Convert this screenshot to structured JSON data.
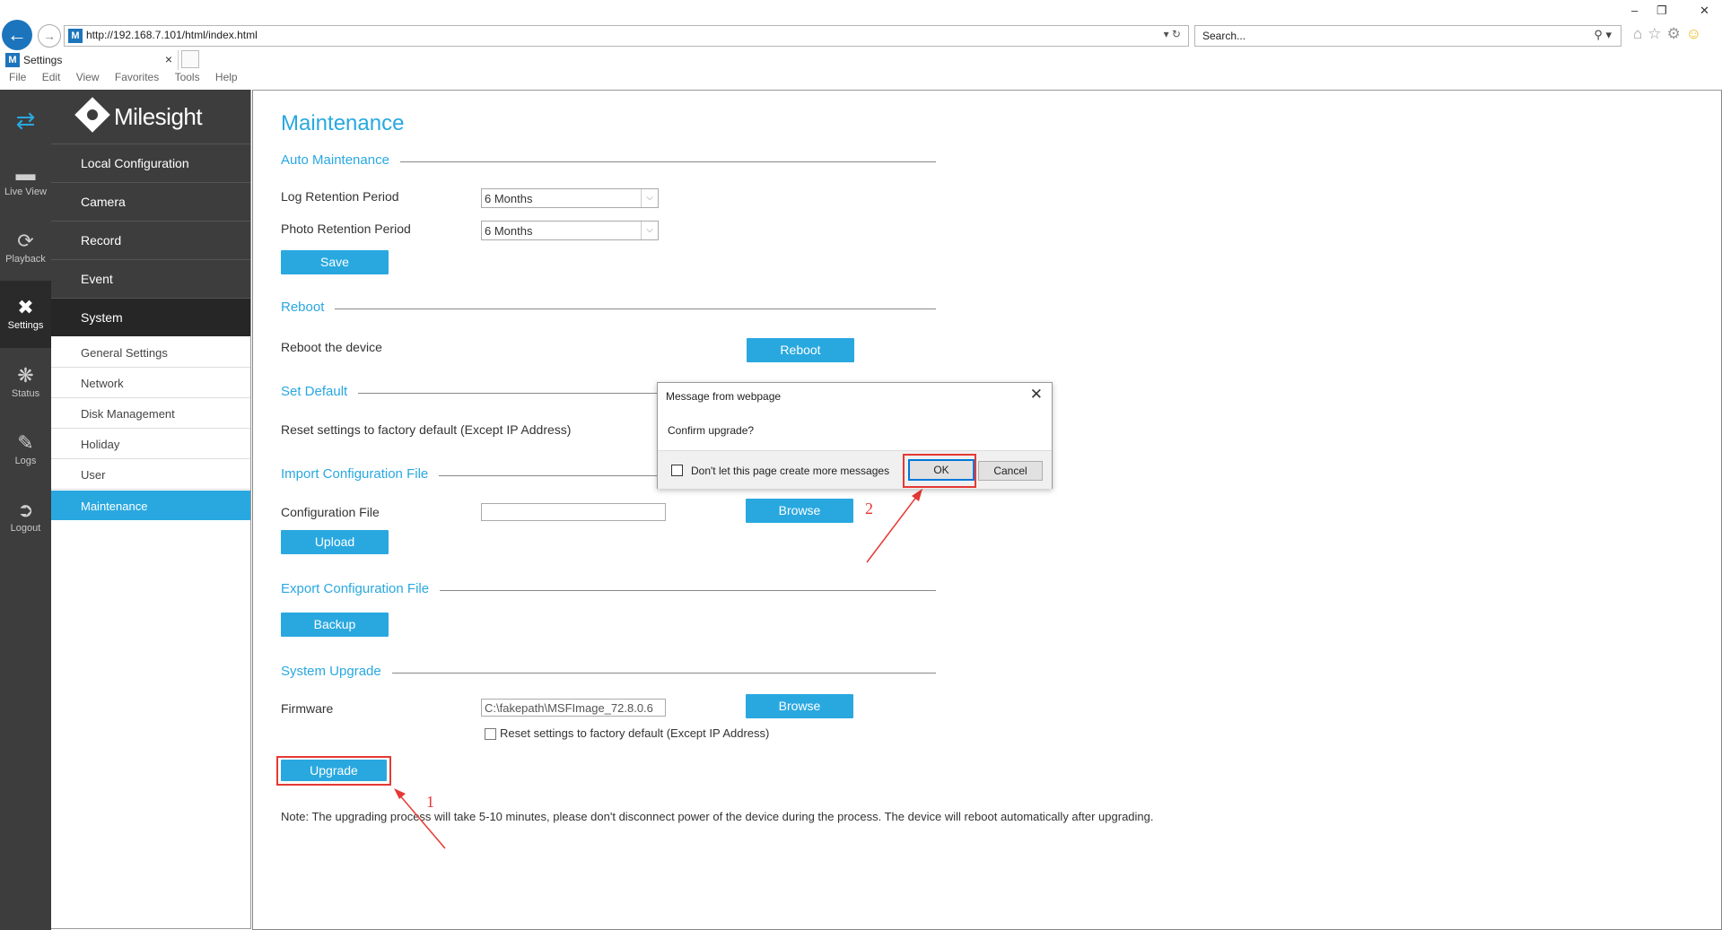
{
  "browser": {
    "url": "http://192.168.7.101/html/index.html",
    "search_placeholder": "Search...",
    "tab_title": "Settings",
    "menu": [
      "File",
      "Edit",
      "View",
      "Favorites",
      "Tools",
      "Help"
    ]
  },
  "brand": {
    "name": "Milesight"
  },
  "iconbar": [
    {
      "label": "",
      "icon": "swap-arrows-icon"
    },
    {
      "label": "Live View",
      "icon": "camera-icon"
    },
    {
      "label": "Playback",
      "icon": "playback-icon"
    },
    {
      "label": "Settings",
      "icon": "tools-icon"
    },
    {
      "label": "Status",
      "icon": "status-icon"
    },
    {
      "label": "Logs",
      "icon": "logs-icon"
    },
    {
      "label": "Logout",
      "icon": "logout-icon"
    }
  ],
  "menu": {
    "main": [
      "Local Configuration",
      "Camera",
      "Record",
      "Event",
      "System"
    ],
    "sub": [
      "General Settings",
      "Network",
      "Disk Management",
      "Holiday",
      "User",
      "Maintenance"
    ]
  },
  "page": {
    "title": "Maintenance",
    "auto": {
      "title": "Auto Maintenance",
      "log_label": "Log Retention Period",
      "log_value": "6 Months",
      "photo_label": "Photo Retention Period",
      "photo_value": "6 Months",
      "save": "Save"
    },
    "reboot": {
      "title": "Reboot",
      "label": "Reboot the device",
      "button": "Reboot"
    },
    "default": {
      "title": "Set Default",
      "label": "Reset settings to factory default (Except IP Address)"
    },
    "import": {
      "title": "Import Configuration File",
      "label": "Configuration File",
      "value": "",
      "browse": "Browse",
      "upload": "Upload"
    },
    "export": {
      "title": "Export Configuration File",
      "backup": "Backup"
    },
    "upgrade": {
      "title": "System Upgrade",
      "label": "Firmware",
      "value": "C:\\fakepath\\MSFImage_72.8.0.6",
      "browse": "Browse",
      "reset_label": "Reset settings to factory default (Except IP Address)",
      "button": "Upgrade",
      "note": "Note: The upgrading process will take 5-10 minutes, please don't disconnect power of the device during the process. The device will reboot automatically after upgrading."
    }
  },
  "dialog": {
    "title": "Message from webpage",
    "message": "Confirm upgrade?",
    "checkbox_label": "Don't let this page create more messages",
    "ok": "OK",
    "cancel": "Cancel"
  },
  "annotations": {
    "step1": "1",
    "step2": "2",
    "color": "#e53935"
  },
  "colors": {
    "accent": "#29a8e0",
    "sidebar": "#3d3d3d"
  }
}
